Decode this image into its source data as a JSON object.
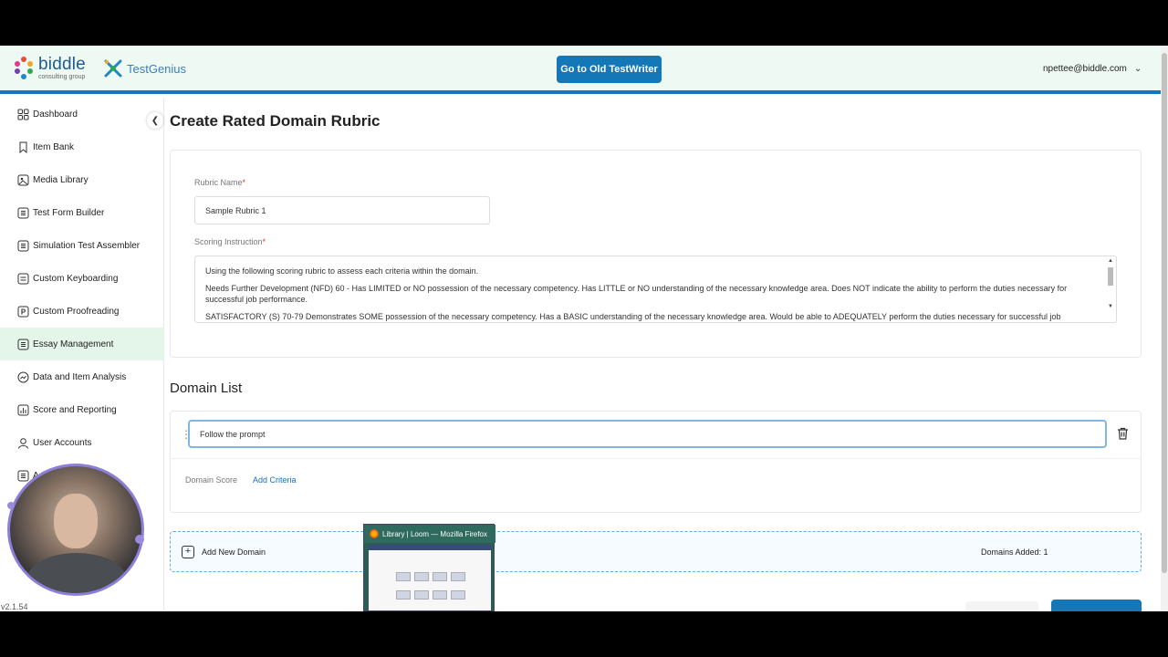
{
  "header": {
    "brand_name": "biddle",
    "brand_sub": "consulting group",
    "product_name": "TestGenius",
    "old_testwriter_label": "Go to Old TestWriter",
    "user_email": "npettee@biddle.com"
  },
  "sidebar": {
    "items": [
      {
        "label": "Dashboard",
        "icon": "grid-icon"
      },
      {
        "label": "Item Bank",
        "icon": "bookmark-icon"
      },
      {
        "label": "Media Library",
        "icon": "image-icon"
      },
      {
        "label": "Test Form Builder",
        "icon": "list-icon"
      },
      {
        "label": "Simulation Test Assembler",
        "icon": "list-icon"
      },
      {
        "label": "Custom Keyboarding",
        "icon": "keyboard-icon"
      },
      {
        "label": "Custom Proofreading",
        "icon": "p-icon"
      },
      {
        "label": "Essay Management",
        "icon": "list-icon"
      },
      {
        "label": "Data and Item Analysis",
        "icon": "chart-icon"
      },
      {
        "label": "Score and Reporting",
        "icon": "bar-chart-icon"
      },
      {
        "label": "User Accounts",
        "icon": "user-icon"
      },
      {
        "label": "A",
        "icon": "list-icon"
      }
    ],
    "version": "v2.1.54"
  },
  "page": {
    "title": "Create Rated Domain Rubric",
    "rubric_name_label": "Rubric Name",
    "rubric_name_value": "Sample Rubric 1",
    "scoring_label": "Scoring Instruction",
    "required_mark": "*",
    "scoring_paragraphs": [
      "Using the following scoring rubric to assess each criteria within the domain.",
      "Needs Further Development (NFD) 60 - Has LIMITED or NO possession of the necessary competency. Has LITTLE or NO understanding of the necessary knowledge area. Does NOT indicate the ability to perform the duties necessary for successful job performance.",
      "SATISFACTORY (S) 70-79 Demonstrates SOME possession of the necessary competency. Has a BASIC understanding of the necessary knowledge area. Would be able to ADEQUATELY perform the duties necessary for successful job"
    ],
    "domain_list_title": "Domain List",
    "domain_name_value": "Follow the prompt",
    "domain_score_label": "Domain Score",
    "add_criteria_label": "Add Criteria",
    "add_domain_label": "Add New Domain",
    "domains_added": "Domains Added: 1"
  },
  "overlay": {
    "window_title": "Library | Loom — Mozilla Firefox"
  }
}
